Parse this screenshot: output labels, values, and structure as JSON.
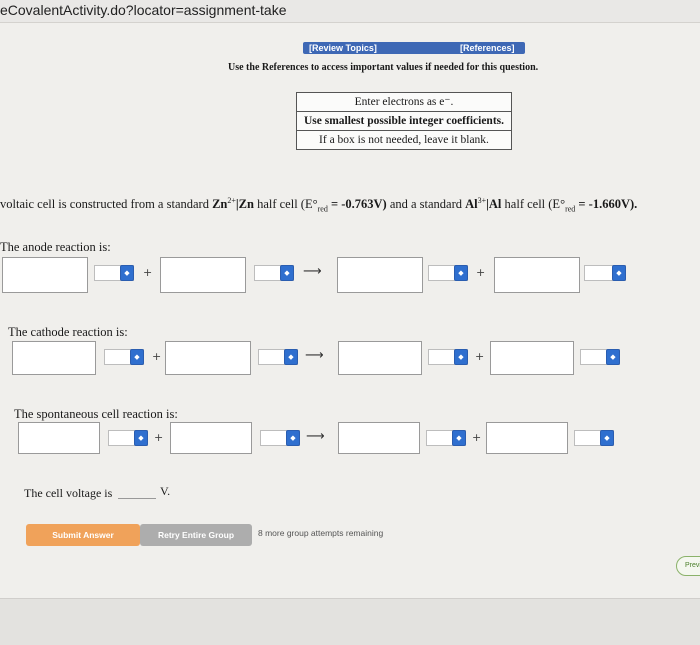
{
  "browser": {
    "url": "eCovalentActivity.do?locator=assignment-take"
  },
  "header": {
    "review_topics": "[Review Topics]",
    "references": "[References]",
    "instructions": "Use the References to access important values if needed for this question."
  },
  "note_box": {
    "line1": "Enter electrons as e⁻.",
    "line2": "Use smallest possible integer coefficients.",
    "line3": "If a box is not needed, leave it blank."
  },
  "question": {
    "p1": "voltaic cell is constructed from a standard ",
    "zn_ion": "Zn",
    "zn_charge": "2+",
    "zn_sep": "|Zn",
    "p2": " half cell (E°",
    "sub": "red",
    "zn_value": " = -0.763V)",
    "p3": " and a standard ",
    "al_ion": "Al",
    "al_charge": "3+",
    "al_sep": "|Al",
    "p4": " half cell (E°",
    "al_value": " = -1.660V)."
  },
  "reactions": {
    "anode_label": "The anode reaction is:",
    "cathode_label": "The cathode reaction is:",
    "spontaneous_label": "The spontaneous cell reaction is:",
    "plus": "+",
    "arrow": "⟶",
    "state_selector_icon": "updown-chevron-icon"
  },
  "voltage": {
    "label": "The cell voltage is",
    "unit": "V."
  },
  "actions": {
    "submit": "Submit Answer",
    "retry": "Retry Entire Group",
    "remaining": "8 more group attempts remaining",
    "previous": "Previous"
  },
  "colors": {
    "link_bar": "#3e68b5",
    "selector_button": "#2f6fcf",
    "submit_button": "#f0a25a",
    "retry_button": "#adadad"
  }
}
